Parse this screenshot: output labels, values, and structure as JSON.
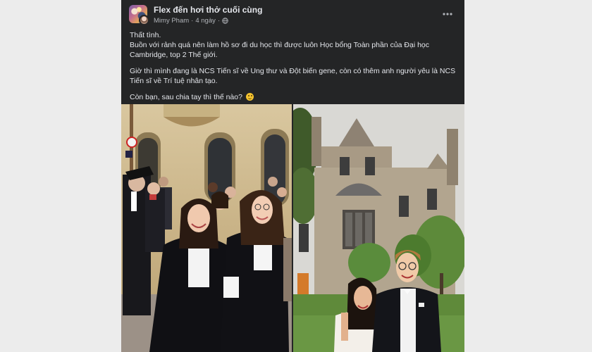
{
  "post": {
    "group_name": "Flex đến hơi thở cuối cùng",
    "author": "Mimy Pham",
    "separator": "·",
    "time": "4 ngày",
    "privacy_icon": "globe-icon",
    "more_icon": "more-options-icon",
    "text": {
      "line1": "Thất tình.",
      "line2": "Buồn với rảnh quá nên làm hồ sơ đi du học thì được luôn Học bổng Toàn phần của Đại học Cambridge, top 2 Thế giới.",
      "paragraph2": "Giờ thì mình đang là NCS Tiến sĩ về Ung thư và Đột biến gene, còn có thêm anh người yêu là NCS Tiến sĩ về Trí tuệ nhân tạo.",
      "paragraph3": "Còn bạn, sau chia tay thì thế nào?",
      "emoji": "smiling-face-emoji"
    },
    "photos": [
      "graduation-procession-photo",
      "couple-in-front-of-college-photo"
    ]
  },
  "colors": {
    "card_bg": "#242526",
    "text_primary": "#e4e6eb",
    "text_secondary": "#b0b3b8"
  }
}
